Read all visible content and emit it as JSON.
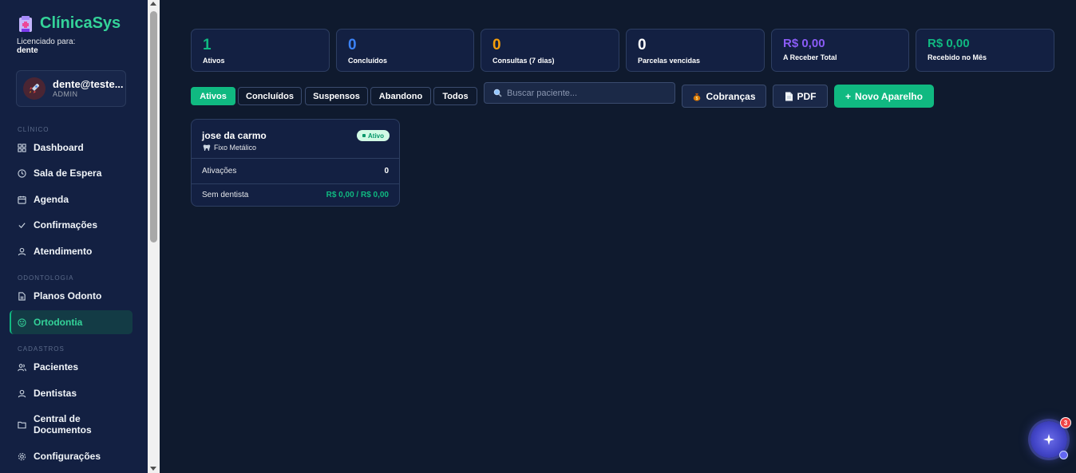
{
  "app": {
    "name": "ClínicaSys",
    "licensed_label": "Licenciado para:",
    "licensed_to": "dente"
  },
  "user": {
    "email": "dente@teste...",
    "role": "ADMIN"
  },
  "sidebar": {
    "sections": [
      "CLÍNICO",
      "ODONTOLOGIA",
      "CADASTROS"
    ],
    "items": [
      {
        "label": "Dashboard",
        "icon": "grid-icon"
      },
      {
        "label": "Sala de Espera",
        "icon": "clock-icon"
      },
      {
        "label": "Agenda",
        "icon": "calendar-icon"
      },
      {
        "label": "Confirmações",
        "icon": "check-icon"
      },
      {
        "label": "Atendimento",
        "icon": "user-icon"
      },
      {
        "label": "Planos Odonto",
        "icon": "document-icon"
      },
      {
        "label": "Ortodontia",
        "icon": "smile-icon",
        "active": true
      },
      {
        "label": "Pacientes",
        "icon": "users-icon"
      },
      {
        "label": "Dentistas",
        "icon": "user-icon"
      },
      {
        "label": "Central de",
        "label2": "Documentos",
        "icon": "folder-icon"
      },
      {
        "label": "Configurações",
        "icon": "settings-icon"
      }
    ]
  },
  "stats": [
    {
      "value": "1",
      "label": "Ativos",
      "color": "#10b981"
    },
    {
      "value": "0",
      "label": "Concluídos",
      "color": "#3b82f6"
    },
    {
      "value": "0",
      "label": "Consultas (7 dias)",
      "color": "#f59e0b"
    },
    {
      "value": "0",
      "label": "Parcelas vencidas",
      "color": "#ffffff"
    },
    {
      "value": "R$ 0,00",
      "label": "A Receber Total",
      "color": "#8b5cf6"
    },
    {
      "value": "R$ 0,00",
      "label": "Recebido no Mês",
      "color": "#10b981"
    }
  ],
  "filters": [
    "Ativos",
    "Concluídos",
    "Suspensos",
    "Abandono",
    "Todos"
  ],
  "active_filter": "Ativos",
  "search": {
    "placeholder": "Buscar paciente..."
  },
  "buttons": {
    "cobrancas": "Cobranças",
    "pdf": "PDF",
    "novo": "Novo Aparelho",
    "novo_prefix": "+"
  },
  "patient_card": {
    "name": "jose da carmo",
    "appliance": "Fixo Metálico",
    "status": "Ativo",
    "activations_label": "Ativações",
    "activations_value": "0",
    "dentist": "Sem dentista",
    "amounts": "R$ 0,00 / R$ 0,00"
  },
  "assistant": {
    "notifications": "3"
  },
  "colors": {
    "accent": "#10b981",
    "bg": "#0f1a2e",
    "sidebar": "#132042"
  }
}
